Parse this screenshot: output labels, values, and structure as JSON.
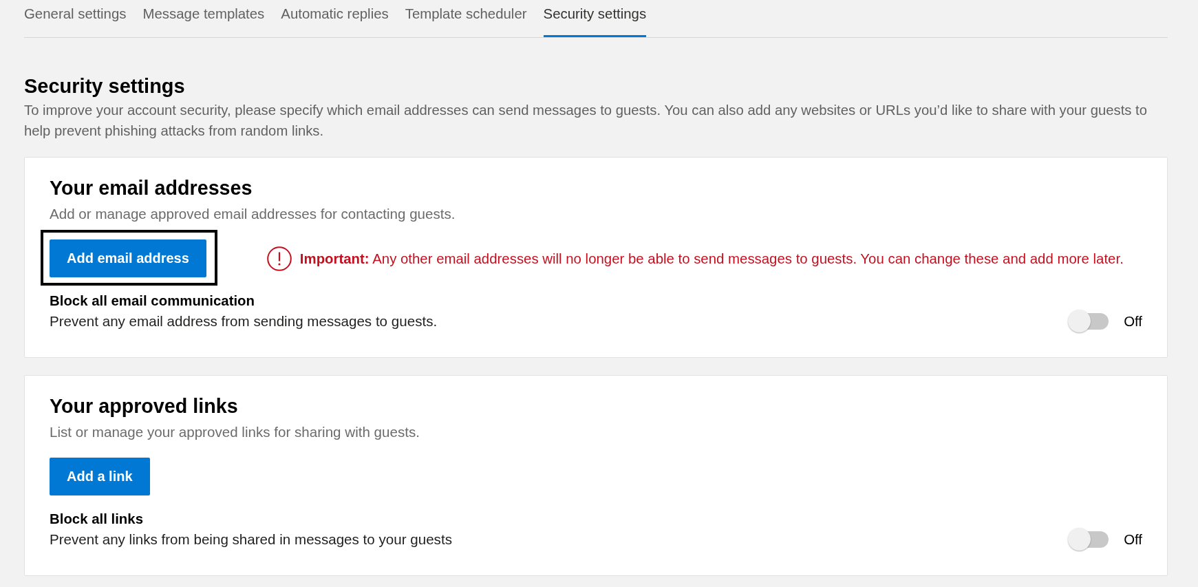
{
  "tabs": [
    {
      "label": "General settings",
      "selected": false
    },
    {
      "label": "Message templates",
      "selected": false
    },
    {
      "label": "Automatic replies",
      "selected": false
    },
    {
      "label": "Template scheduler",
      "selected": false
    },
    {
      "label": "Security settings",
      "selected": true
    }
  ],
  "page": {
    "title": "Security settings",
    "description": "To improve your account security, please specify which email addresses can send messages to guests. You can also add any websites or URLs you’d like to share with your guests to help prevent phishing attacks from random links."
  },
  "sections": [
    {
      "title": "Your email addresses",
      "subtitle": "Add or manage approved email addresses for contacting guests.",
      "button": {
        "label": "Add email address",
        "focused": true
      },
      "notice": "**Important:** Any other email addresses will no longer be able to send messages to guests. You can change these and add more later.",
      "setting": {
        "label": "Block all email communication",
        "description": "Prevent any email address from sending messages to guests.",
        "on": false,
        "state_label": "Off"
      }
    },
    {
      "title": "Your approved links",
      "subtitle": "List or manage your approved links for sharing with guests.",
      "button": {
        "label": "Add a link",
        "focused": false
      },
      "setting": {
        "label": "Block all links",
        "description": "Prevent any links from being shared in messages to your guests",
        "on": false,
        "state_label": "Off"
      }
    }
  ]
}
